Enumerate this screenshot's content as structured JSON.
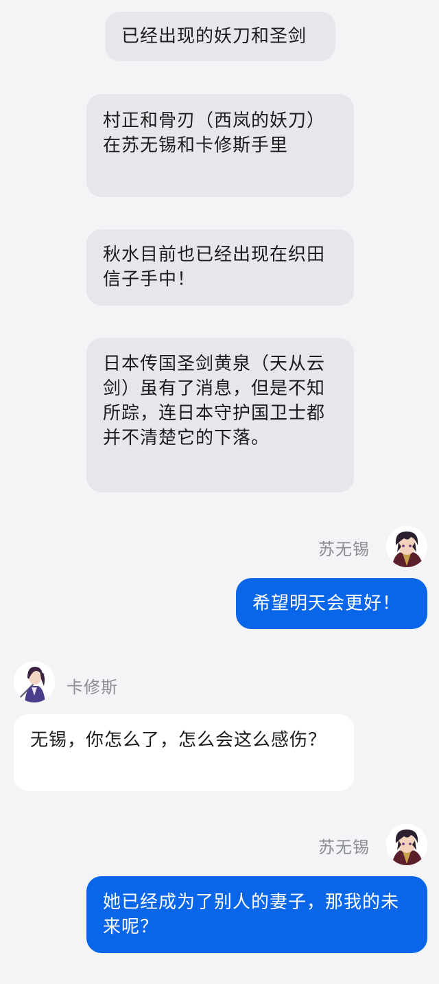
{
  "narration": [
    "已经出现的妖刀和圣剑",
    "村正和骨刃（西岚的妖刀）在苏无锡和卡修斯手里",
    "秋水目前也已经出现在织田信子手中！",
    "日本传国圣剑黄泉（天从云剑）虽有了消息，但是不知所踪，连日本守护国卫士都并不清楚它的下落。"
  ],
  "messages": [
    {
      "sender": "苏无锡",
      "avatar_icon": "dark-haired-character-avatar-icon",
      "text": "希望明天会更好！"
    },
    {
      "sender": "卡修斯",
      "avatar_icon": "swordsman-character-avatar-icon",
      "text": "无锡，你怎么了，怎么会这么感伤？"
    },
    {
      "sender": "苏无锡",
      "avatar_icon": "dark-haired-character-avatar-icon",
      "text": "她已经成为了别人的妻子，那我的未来呢？"
    }
  ],
  "colors": {
    "background": "#f4f4f6",
    "narration_bubble": "#e6e7ec",
    "my_bubble": "#0a66e8",
    "other_bubble": "#ffffff",
    "name_text": "#8a8d96"
  }
}
